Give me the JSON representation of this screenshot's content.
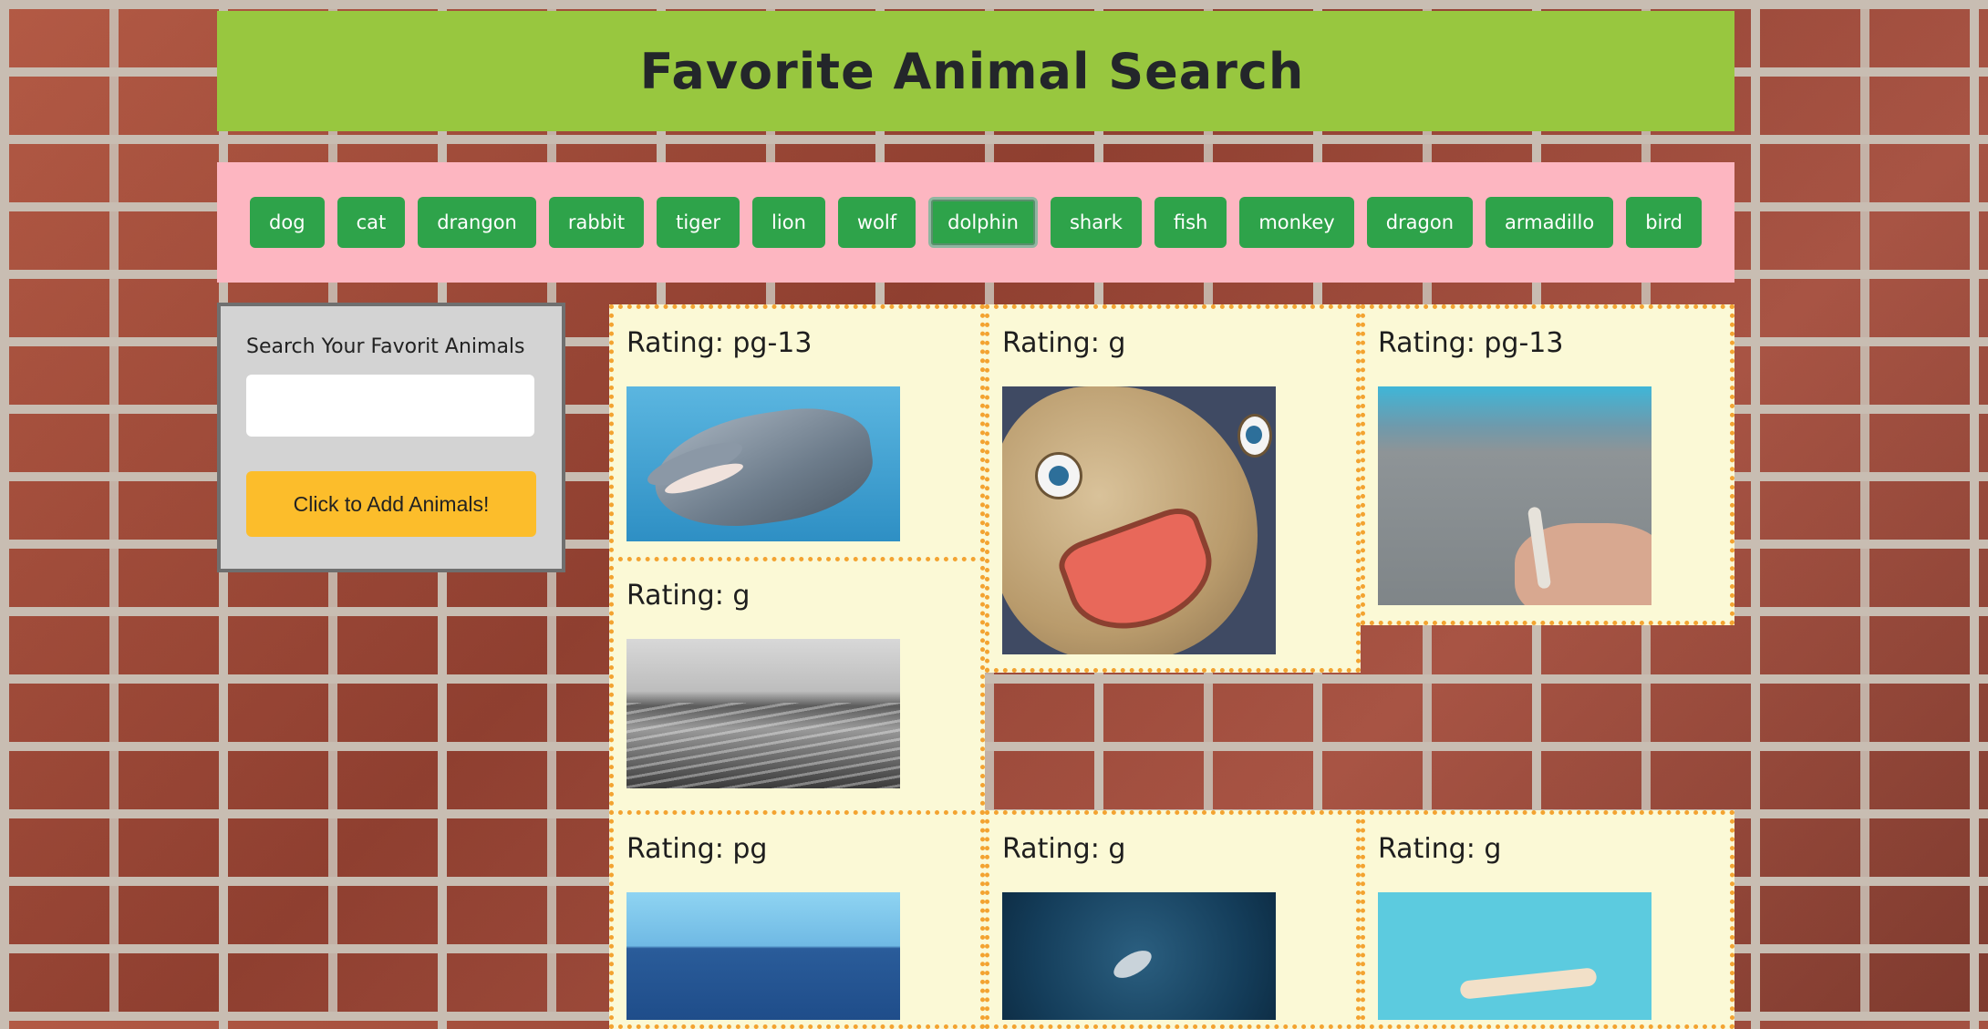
{
  "header": {
    "title": "Favorite Animal Search"
  },
  "animal_buttons": [
    {
      "label": "dog",
      "active": false
    },
    {
      "label": "cat",
      "active": false
    },
    {
      "label": "drangon",
      "active": false
    },
    {
      "label": "rabbit",
      "active": false
    },
    {
      "label": "tiger",
      "active": false
    },
    {
      "label": "lion",
      "active": false
    },
    {
      "label": "wolf",
      "active": false
    },
    {
      "label": "dolphin",
      "active": true
    },
    {
      "label": "shark",
      "active": false
    },
    {
      "label": "fish",
      "active": false
    },
    {
      "label": "monkey",
      "active": false
    },
    {
      "label": "dragon",
      "active": false
    },
    {
      "label": "armadillo",
      "active": false
    },
    {
      "label": "bird",
      "active": false
    }
  ],
  "form": {
    "label": "Search Your Favorit Animals",
    "input_value": "",
    "submit_label": "Click to Add Animals!"
  },
  "results": [
    {
      "rating": "Rating: pg-13",
      "gif": "dolphin-mouth-open"
    },
    {
      "rating": "Rating: g",
      "gif": "cartoon-dolphin-face"
    },
    {
      "rating": "Rating: pg-13",
      "gif": "hand-by-pool"
    },
    {
      "rating": "Rating: g",
      "gif": "black-white-sea"
    },
    {
      "rating": "Rating: pg",
      "gif": "blue-ocean-horizon"
    },
    {
      "rating": "Rating: g",
      "gif": "dolphin-deep-ocean"
    },
    {
      "rating": "Rating: g",
      "gif": "swimmer-cyan"
    }
  ],
  "colors": {
    "header_bg": "#98c73f",
    "button_bar_bg": "#fdb6c1",
    "animal_button": "#2ea34a",
    "add_button": "#fcbd2b",
    "card_bg": "#fbf9d6",
    "card_border": "#f3a331"
  }
}
